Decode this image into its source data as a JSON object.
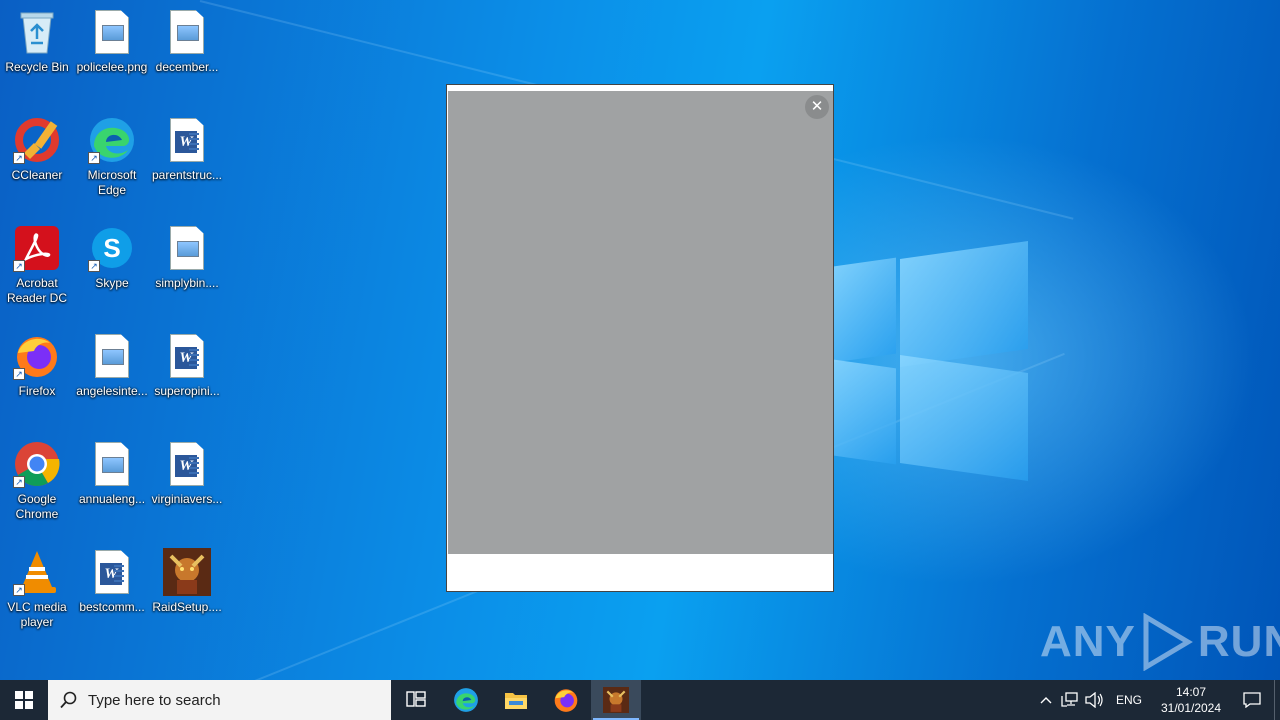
{
  "desktop": {
    "icons": [
      {
        "label": "Recycle Bin",
        "icon": "recycle-bin-icon"
      },
      {
        "label": "policelee.png",
        "icon": "image-file-icon"
      },
      {
        "label": "december...",
        "icon": "image-file-icon"
      },
      {
        "label": "CCleaner",
        "icon": "ccleaner-icon"
      },
      {
        "label": "Microsoft\nEdge",
        "icon": "edge-icon"
      },
      {
        "label": "parentstruc...",
        "icon": "word-doc-icon"
      },
      {
        "label": "Acrobat\nReader DC",
        "icon": "acrobat-icon"
      },
      {
        "label": "Skype",
        "icon": "skype-icon"
      },
      {
        "label": "simplybin....",
        "icon": "image-file-icon"
      },
      {
        "label": "Firefox",
        "icon": "firefox-icon"
      },
      {
        "label": "angelesinte...",
        "icon": "image-file-icon"
      },
      {
        "label": "superopini...",
        "icon": "word-doc-icon"
      },
      {
        "label": "Google\nChrome",
        "icon": "chrome-icon"
      },
      {
        "label": "annualeng...",
        "icon": "image-file-icon"
      },
      {
        "label": "virginiavers...",
        "icon": "word-doc-icon"
      },
      {
        "label": "VLC media\nplayer",
        "icon": "vlc-icon"
      },
      {
        "label": "bestcomm...",
        "icon": "word-doc-icon"
      },
      {
        "label": "RaidSetup....",
        "icon": "raid-setup-icon"
      }
    ]
  },
  "popup": {
    "close_glyph": "✕"
  },
  "watermark": {
    "left": "ANY",
    "right": "RUN"
  },
  "taskbar": {
    "search_placeholder": "Type here to search",
    "apps": [
      "task-view",
      "edge",
      "file-explorer",
      "firefox",
      "raid-setup"
    ],
    "active_app": "raid-setup",
    "language": "ENG",
    "time": "14:07",
    "date": "31/01/2024"
  },
  "colors": {
    "taskbar_bg": "#1c2836",
    "popup_content_bg": "#a0a2a3",
    "desktop_accent": "#0078d7"
  }
}
